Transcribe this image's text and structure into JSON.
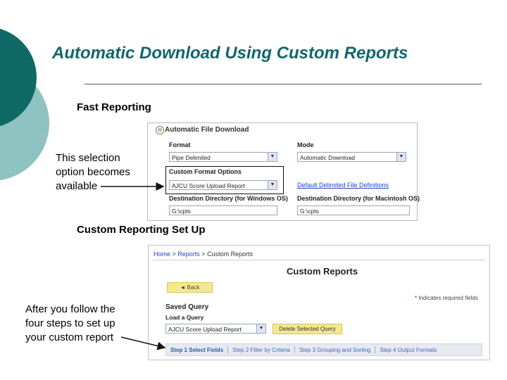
{
  "slide": {
    "title": "Automatic Download Using Custom Reports",
    "fast_caption": "Fast Reporting",
    "custom_caption": "Custom Reporting Set Up",
    "note1": [
      "This selection",
      "option becomes",
      "available"
    ],
    "note2": [
      "After you follow the",
      "four steps to set up",
      "your custom report"
    ]
  },
  "fast_panel": {
    "title": "Automatic File Download",
    "expand_glyph": "⊖",
    "format_label": "Format",
    "format_value": "Pipe Delimited",
    "mode_label": "Mode",
    "mode_value": "Automatic Download",
    "custom_options_label": "Custom Format Options",
    "custom_options_value": "AJCU Score Upload Report",
    "default_link": "Default Delimited File Definitions",
    "win_dir_label": "Destination Directory (for Windows OS)",
    "win_dir_value": "G:\\cpts",
    "mac_dir_label": "Destination Directory (for Macintosh OS)",
    "mac_dir_value": "G:\\cpts",
    "dropdown_glyph": "▼"
  },
  "custom_panel": {
    "breadcrumb": {
      "home": "Home",
      "sep": " > ",
      "reports": "Reports",
      "current": "Custom Reports"
    },
    "title": "Custom Reports",
    "back_label": "◄ Back",
    "required_star": "*",
    "required_text": " Indicates required fields",
    "saved_query": "Saved Query",
    "load_query": "Load a Query",
    "query_value": "AJCU Score Upload Report",
    "delete_label": "Delete Selected Query",
    "steps": [
      {
        "label": "Step 1  Select Fields",
        "active": true
      },
      {
        "label": "Step 2  Filter by Criteria",
        "active": false
      },
      {
        "label": "Step 3  Grouping and Sorting",
        "active": false
      },
      {
        "label": "Step 4  Output Formats",
        "active": false
      }
    ]
  },
  "colors": {
    "teal_dark": "#0f6a66",
    "teal_light": "#8fc3c1",
    "title": "#12666b",
    "button": "#f5e98c"
  }
}
